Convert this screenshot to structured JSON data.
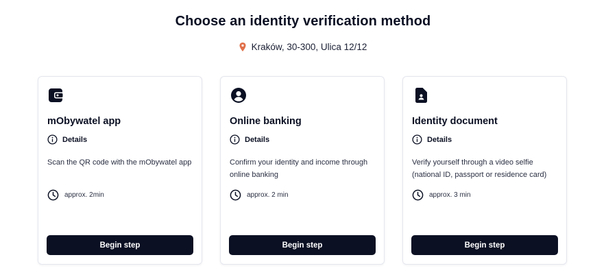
{
  "header": {
    "title": "Choose an identity verification method",
    "location": "Kraków, 30-300, Ulica 12/12",
    "location_icon": "map-pin-icon",
    "accent_color": "#e0704a"
  },
  "cards": [
    {
      "icon": "wallet-icon",
      "title": "mObywatel app",
      "details_label": "Details",
      "description": "Scan the QR code with the mObywatel app",
      "duration": "approx. 2min",
      "button_label": "Begin step"
    },
    {
      "icon": "user-circle-icon",
      "title": "Online banking",
      "details_label": "Details",
      "description": "Confirm your identity and income through online banking",
      "duration": "approx. 2 min",
      "button_label": "Begin step"
    },
    {
      "icon": "id-document-icon",
      "title": "Identity document",
      "details_label": "Details",
      "description": "Verify yourself through a video selfie (national ID, passport or residence card)",
      "duration": "approx. 3 min",
      "button_label": "Begin step"
    }
  ]
}
